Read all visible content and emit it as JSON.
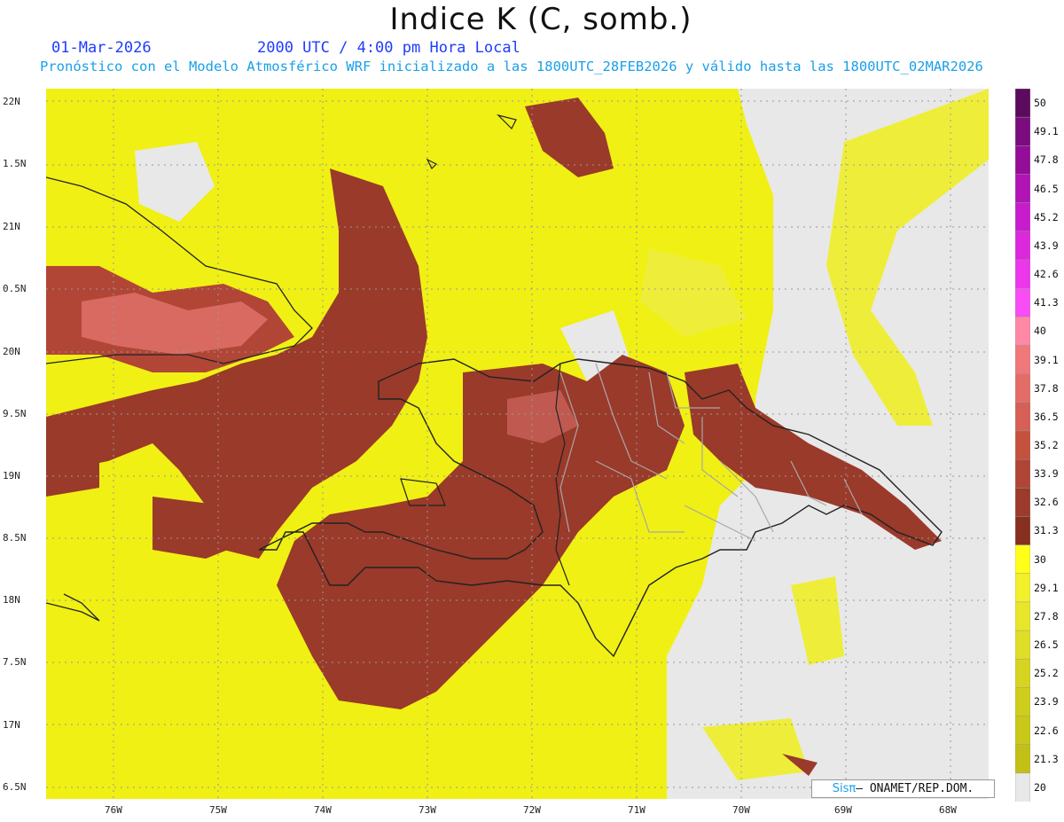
{
  "title": "Indice K (C, somb.)",
  "date": "01-Mar-2026",
  "time": "2000 UTC / 4:00 pm Hora Local",
  "subtitle": "Pronóstico con el Modelo Atmosférico WRF inicializado a las 1800UTC_28FEB2026 y válido hasta las  1800UTC_02MAR2026",
  "credit": {
    "brand": "Sisπ",
    "org": "– ONAMET/REP.DOM."
  },
  "axes": {
    "lon_labels": [
      "76W",
      "75W",
      "74W",
      "73W",
      "72W",
      "71W",
      "70W",
      "69W",
      "68W"
    ],
    "lat_labels": [
      "22N",
      "1.5N",
      "21N",
      "0.5N",
      "20N",
      "9.5N",
      "19N",
      "8.5N",
      "18N",
      "7.5N",
      "17N",
      "6.5N"
    ],
    "lon_range": [
      -76.6,
      -67.6
    ],
    "lat_range": [
      16.5,
      22.1
    ]
  },
  "colors": {
    "low": "#e8e8e8",
    "band_20_30": "#eeee22",
    "band_30_40": "#9a3a2a",
    "band_30_40_high": "#d46a60",
    "ocean_no_data": "#e8e8e8",
    "border_country": "#222222",
    "border_province": "#a8a8a8"
  },
  "colorbar": {
    "levels": [
      "50",
      "49.1",
      "47.8",
      "46.5",
      "45.2",
      "43.9",
      "42.6",
      "41.3",
      "40",
      "39.1",
      "37.8",
      "36.5",
      "35.2",
      "33.9",
      "32.6",
      "31.3",
      "30",
      "29.1",
      "27.8",
      "26.5",
      "25.2",
      "23.9",
      "22.6",
      "21.3",
      "20"
    ],
    "colors": [
      "#5c0a5e",
      "#7a0c7e",
      "#940c98",
      "#b014b4",
      "#c81ccc",
      "#dc28dc",
      "#ec36ea",
      "#f84cf4",
      "#ff88a4",
      "#f0787a",
      "#e46c68",
      "#d65f56",
      "#c4503e",
      "#b04536",
      "#9c3a2c",
      "#88301f",
      "#ffff1a",
      "#f2f02a",
      "#e8e62a",
      "#dede26",
      "#d6d420",
      "#cece1a",
      "#c8c818",
      "#c2c014",
      "#e8e8e8"
    ]
  }
}
